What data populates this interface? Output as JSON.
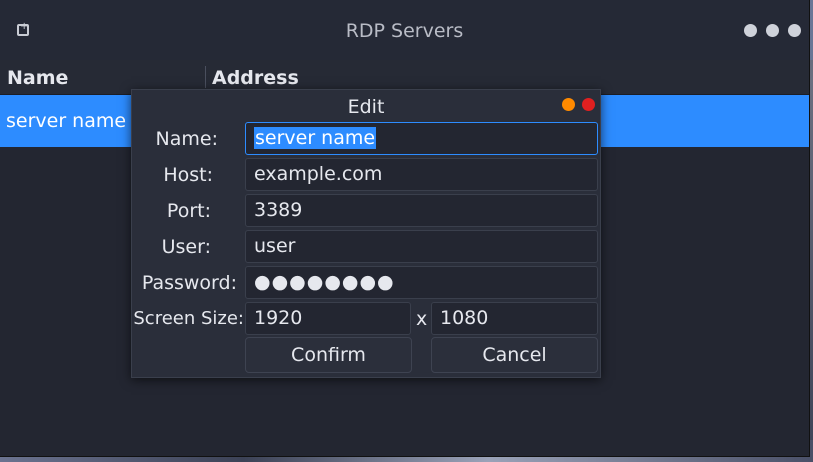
{
  "window": {
    "title": "RDP Servers",
    "columns": [
      "Name",
      "Address"
    ],
    "rows": [
      {
        "name": "server name",
        "address": ""
      }
    ]
  },
  "dialog": {
    "title": "Edit",
    "fields": {
      "name": {
        "label": "Name:",
        "value": "server name"
      },
      "host": {
        "label": "Host:",
        "value": "example.com"
      },
      "port": {
        "label": "Port:",
        "value": "3389"
      },
      "user": {
        "label": "User:",
        "value": "user"
      },
      "password": {
        "label": "Password:",
        "value": "●●●●●●●●"
      },
      "screen_size": {
        "label": "Screen Size:",
        "width": "1920",
        "separator": "x",
        "height": "1080"
      }
    },
    "confirm_label": "Confirm",
    "cancel_label": "Cancel"
  },
  "colors": {
    "accent": "#2d8cff",
    "minimize": "#ff8a00",
    "close": "#e02020",
    "window_bg": "#232631"
  },
  "icons": [
    "app-icon",
    "window-button-icon",
    "minimize-icon",
    "close-icon"
  ]
}
